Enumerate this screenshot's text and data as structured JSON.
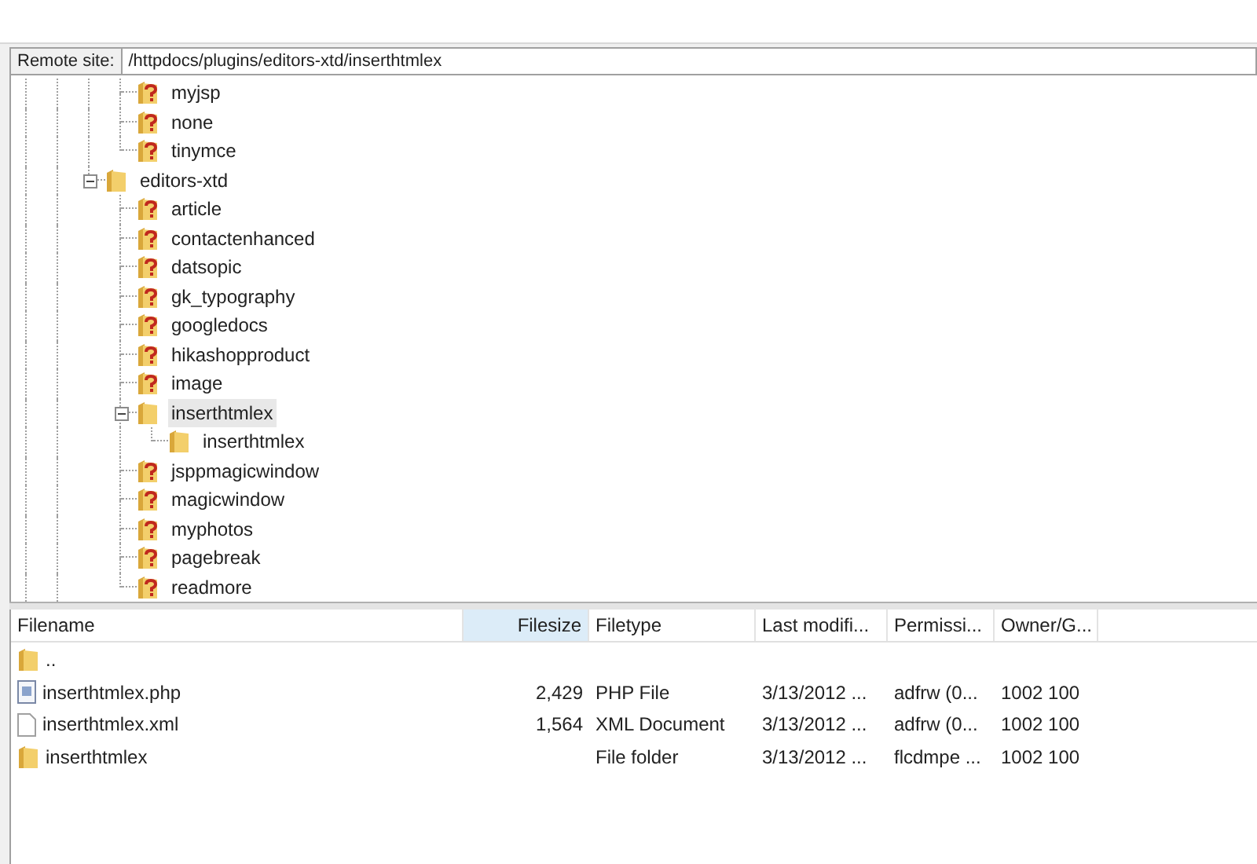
{
  "address_bar": {
    "label": "Remote site:",
    "value": "/httpdocs/plugins/editors-xtd/inserthtmlex"
  },
  "tree": [
    {
      "children": [
        {
          "label": "myjsp",
          "kind": "unknown",
          "selected": false
        },
        {
          "label": "none",
          "kind": "unknown",
          "selected": false
        },
        {
          "label": "tinymce",
          "kind": "unknown",
          "selected": false
        }
      ]
    },
    {
      "label": "editors-xtd",
      "kind": "folder",
      "expanded": true,
      "selected": false,
      "children": [
        {
          "label": "article",
          "kind": "unknown",
          "selected": false
        },
        {
          "label": "contactenhanced",
          "kind": "unknown",
          "selected": false
        },
        {
          "label": "datsopic",
          "kind": "unknown",
          "selected": false
        },
        {
          "label": "gk_typography",
          "kind": "unknown",
          "selected": false
        },
        {
          "label": "googledocs",
          "kind": "unknown",
          "selected": false
        },
        {
          "label": "hikashopproduct",
          "kind": "unknown",
          "selected": false
        },
        {
          "label": "image",
          "kind": "unknown",
          "selected": false
        },
        {
          "label": "inserthtmlex",
          "kind": "folder",
          "expanded": true,
          "selected": true,
          "children": [
            {
              "label": "inserthtmlex",
              "kind": "folder",
              "selected": false
            }
          ]
        },
        {
          "label": "jsppmagicwindow",
          "kind": "unknown",
          "selected": false
        },
        {
          "label": "magicwindow",
          "kind": "unknown",
          "selected": false
        },
        {
          "label": "myphotos",
          "kind": "unknown",
          "selected": false
        },
        {
          "label": "pagebreak",
          "kind": "unknown",
          "selected": false
        },
        {
          "label": "readmore",
          "kind": "unknown",
          "selected": false
        }
      ]
    }
  ],
  "file_list": {
    "columns": [
      {
        "label": "Filename",
        "sorted": false
      },
      {
        "label": "Filesize",
        "sorted": true
      },
      {
        "label": "Filetype",
        "sorted": false
      },
      {
        "label": "Last modifi...",
        "sorted": false
      },
      {
        "label": "Permissi...",
        "sorted": false
      },
      {
        "label": "Owner/G...",
        "sorted": false
      }
    ],
    "rows": [
      {
        "kind": "folder",
        "cells": [
          "..",
          "",
          "",
          "",
          "",
          ""
        ]
      },
      {
        "kind": "php",
        "cells": [
          "inserthtmlex.php",
          "2,429",
          "PHP File",
          "3/13/2012 ...",
          "adfrw (0...",
          "1002 100"
        ]
      },
      {
        "kind": "file",
        "cells": [
          "inserthtmlex.xml",
          "1,564",
          "XML Document",
          "3/13/2012 ...",
          "adfrw (0...",
          "1002 100"
        ]
      },
      {
        "kind": "folder",
        "cells": [
          "inserthtmlex",
          "",
          "File folder",
          "3/13/2012 ...",
          "flcdmpe ...",
          "1002 100"
        ]
      }
    ]
  }
}
